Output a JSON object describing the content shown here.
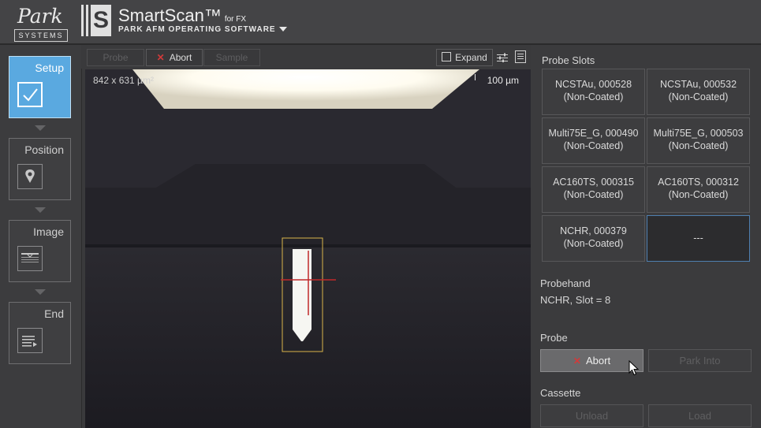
{
  "header": {
    "logo_word": "Park",
    "logo_sub": "SYSTEMS",
    "brand_letter": "S",
    "title": "SmartScan™",
    "title_suffix": "for FX",
    "subtitle": "PARK AFM OPERATING SOFTWARE"
  },
  "steps": [
    {
      "label": "Setup",
      "icon": "checkmark-icon",
      "active": true
    },
    {
      "label": "Position",
      "icon": "location-pin-icon",
      "active": false
    },
    {
      "label": "Image",
      "icon": "image-scan-icon",
      "active": false
    },
    {
      "label": "End",
      "icon": "end-list-icon",
      "active": false
    }
  ],
  "camera_toolbar": {
    "probe_label": "Probe",
    "abort_label": "Abort",
    "sample_label": "Sample",
    "expand_label": "Expand"
  },
  "camera": {
    "fov_readout": "842 x 631 µm²",
    "scale_label": "100 µm"
  },
  "probe_slots": {
    "title": "Probe Slots",
    "slots": [
      {
        "name": "NCSTAu, 000528",
        "coating": "(Non-Coated)"
      },
      {
        "name": "NCSTAu, 000532",
        "coating": "(Non-Coated)"
      },
      {
        "name": "Multi75E_G, 000490",
        "coating": "(Non-Coated)"
      },
      {
        "name": "Multi75E_G, 000503",
        "coating": "(Non-Coated)"
      },
      {
        "name": "AC160TS, 000315",
        "coating": "(Non-Coated)"
      },
      {
        "name": "AC160TS, 000312",
        "coating": "(Non-Coated)"
      },
      {
        "name": "NCHR, 000379",
        "coating": "(Non-Coated)"
      },
      {
        "name": "---",
        "coating": ""
      }
    ]
  },
  "probehand": {
    "title": "Probehand",
    "value": "NCHR, Slot = 8"
  },
  "probe_actions": {
    "title": "Probe",
    "abort_label": "Abort",
    "park_label": "Park Into"
  },
  "cassette": {
    "title": "Cassette",
    "unload_label": "Unload",
    "load_label": "Load"
  },
  "colors": {
    "active_step": "#5aa9e0",
    "abort_x": "#d23a3a",
    "selected_slot_border": "#4f7fb0",
    "crosshair": "#c0282a",
    "probe_box": "#d9b44a"
  }
}
